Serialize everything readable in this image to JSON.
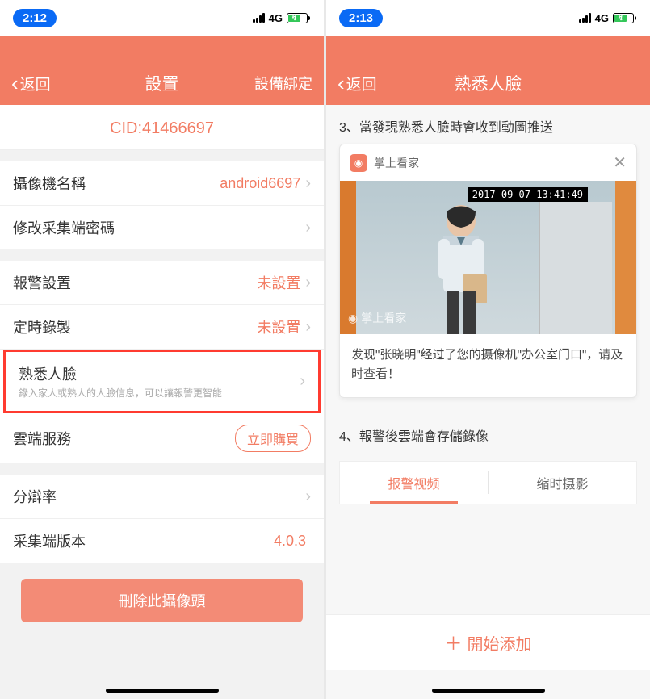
{
  "left": {
    "status": {
      "time": "2:12",
      "network": "4G"
    },
    "header": {
      "back": "返回",
      "title": "設置",
      "right": "設備綁定"
    },
    "cid": "CID:41466697",
    "rows": {
      "camera_name_label": "攝像機名稱",
      "camera_name_value": "android6697",
      "password_label": "修改采集端密碼",
      "alarm_label": "報警設置",
      "alarm_value": "未設置",
      "record_label": "定時錄製",
      "record_value": "未設置",
      "face_label": "熟悉人臉",
      "face_sub": "錄入家人或熟人的人臉信息，可以讓報警更智能",
      "cloud_label": "雲端服務",
      "cloud_button": "立即購買",
      "resolution_label": "分辯率",
      "version_label": "采集端版本",
      "version_value": "4.0.3"
    },
    "delete_button": "刪除此攝像頭"
  },
  "right": {
    "status": {
      "time": "2:13",
      "network": "4G"
    },
    "header": {
      "back": "返回",
      "title": "熟悉人臉"
    },
    "section3_label": "3、當發現熟悉人臉時會收到動圖推送",
    "card": {
      "app_name": "掌上看家",
      "timestamp": "2017-09-07 13:41:49",
      "watermark": "掌上看家",
      "text": "发现\"张晓明\"经过了您的摄像机\"办公室门口\"，请及时查看！"
    },
    "section4_label": "4、報警後雲端會存儲錄像",
    "tabs": {
      "tab1": "报警视频",
      "tab2": "缩时摄影"
    },
    "add_button": "開始添加"
  }
}
